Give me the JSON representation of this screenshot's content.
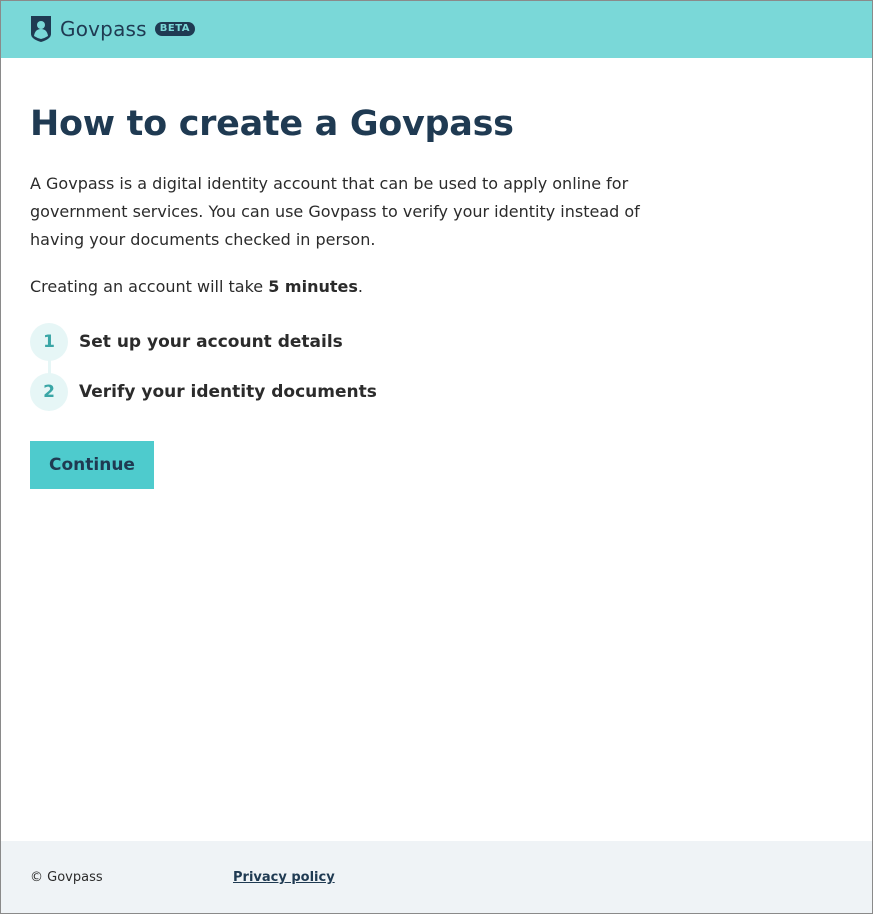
{
  "header": {
    "brand_name": "Govpass",
    "badge": "BETA",
    "colors": {
      "background": "#7ad8d8",
      "text": "#1f3a52"
    }
  },
  "main": {
    "title": "How to create a Govpass",
    "intro": "A Govpass is a digital identity account that can be used to apply online for government services. You can use Govpass to verify your identity instead of having your documents checked in person.",
    "duration_prefix": "Creating an account will take ",
    "duration_value": "5 minutes",
    "duration_suffix": ".",
    "steps": [
      {
        "number": "1",
        "label": "Set up your account details"
      },
      {
        "number": "2",
        "label": "Verify your identity documents"
      }
    ],
    "continue_label": "Continue"
  },
  "footer": {
    "copyright": "© Govpass",
    "privacy_link": "Privacy policy"
  },
  "colors": {
    "accent": "#4ecbcd",
    "heading": "#1f3a52",
    "step_circle": "#e6f6f6",
    "step_number": "#3aa6a6",
    "footer_bg": "#eff3f6"
  },
  "icons": {
    "logo": "shield-user-icon"
  }
}
